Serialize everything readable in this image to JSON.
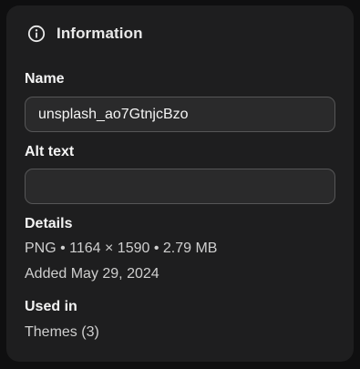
{
  "panel": {
    "title": "Information",
    "icon": "info-icon"
  },
  "name": {
    "label": "Name",
    "value": "unsplash_ao7GtnjcBzo"
  },
  "alt_text": {
    "label": "Alt text",
    "value": ""
  },
  "details": {
    "label": "Details",
    "summary": "PNG • 1164 × 1590 • 2.79 MB",
    "added": "Added May 29, 2024"
  },
  "used_in": {
    "label": "Used in",
    "value": "Themes (3)"
  },
  "colors": {
    "panel_bg": "#1e1e1f",
    "field_bg": "#2a2a2b",
    "field_border": "#565657"
  }
}
